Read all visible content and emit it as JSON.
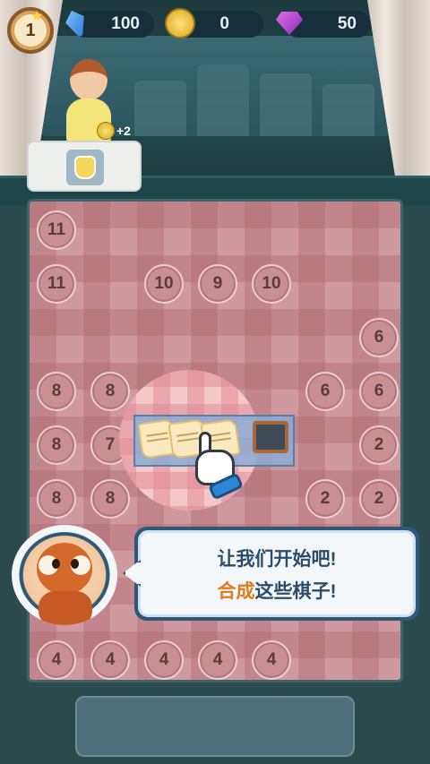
{
  "hud": {
    "level": "1",
    "energy": "100",
    "coins": "0",
    "gems": "50"
  },
  "order": {
    "reward": "+2",
    "item_icon": "lemonade-icon"
  },
  "board": {
    "rows": [
      [
        "11",
        "",
        "",
        "",
        "",
        "",
        ""
      ],
      [
        "11",
        "",
        "10",
        "9",
        "10",
        "",
        ""
      ],
      [
        "",
        "",
        "",
        "",
        "",
        "",
        "6"
      ],
      [
        "8",
        "8",
        "",
        "",
        "",
        "6",
        "6"
      ],
      [
        "8",
        "7",
        "",
        "",
        "",
        "",
        "2"
      ],
      [
        "8",
        "8",
        "",
        "",
        "",
        "2",
        "2"
      ],
      [
        "",
        "",
        "",
        "",
        "",
        "",
        ""
      ],
      [
        "",
        "",
        "",
        "",
        "",
        "",
        ""
      ],
      [
        "4",
        "4",
        "4",
        "4",
        "4",
        "",
        ""
      ]
    ]
  },
  "tutorial": {
    "line1": "让我们开始吧!",
    "line2_highlight": "合成",
    "line2_rest": "这些棋子!"
  },
  "colors": {
    "highlight_text": "#e07a1a",
    "dialog_text": "#2b4d69",
    "board_tile": "#cf9a9f"
  }
}
